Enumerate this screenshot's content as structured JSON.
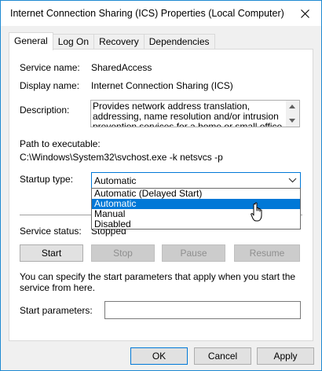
{
  "window": {
    "title": "Internet Connection Sharing (ICS) Properties (Local Computer)"
  },
  "tabs": [
    {
      "label": "General",
      "active": true
    },
    {
      "label": "Log On",
      "active": false
    },
    {
      "label": "Recovery",
      "active": false
    },
    {
      "label": "Dependencies",
      "active": false
    }
  ],
  "general": {
    "service_name_label": "Service name:",
    "service_name_value": "SharedAccess",
    "display_name_label": "Display name:",
    "display_name_value": "Internet Connection Sharing (ICS)",
    "description_label": "Description:",
    "description_value": "Provides network address translation, addressing, name resolution and/or intrusion prevention services for a home or small office network.",
    "path_label": "Path to executable:",
    "path_value": "C:\\Windows\\System32\\svchost.exe -k netsvcs -p",
    "startup_type_label": "Startup type:",
    "startup_type_value": "Automatic",
    "startup_options": [
      "Automatic (Delayed Start)",
      "Automatic",
      "Manual",
      "Disabled"
    ],
    "startup_selected_index": 1,
    "service_status_label": "Service status:",
    "service_status_value": "Stopped",
    "buttons": {
      "start": "Start",
      "stop": "Stop",
      "pause": "Pause",
      "resume": "Resume"
    },
    "info_text": "You can specify the start parameters that apply when you start the service from here.",
    "start_params_label": "Start parameters:",
    "start_params_value": ""
  },
  "dialog_buttons": {
    "ok": "OK",
    "cancel": "Cancel",
    "apply": "Apply"
  },
  "colors": {
    "accent": "#0078d7",
    "window_border": "#1f8ad2"
  }
}
